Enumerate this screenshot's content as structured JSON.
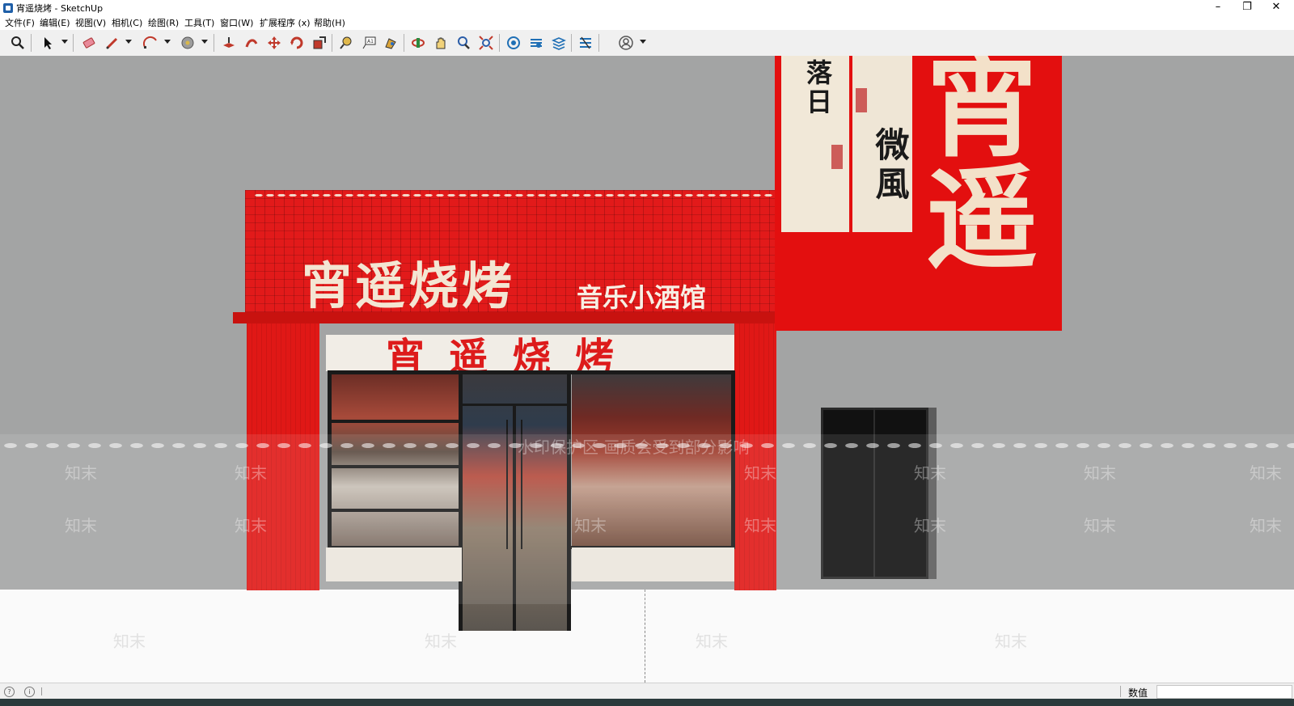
{
  "window": {
    "title": "宵遥烧烤 - SketchUp",
    "minimize": "–",
    "restore": "❐",
    "close": "✕"
  },
  "menu": [
    "文件(F)",
    "编辑(E)",
    "视图(V)",
    "相机(C)",
    "绘图(R)",
    "工具(T)",
    "窗口(W)",
    "扩展程序 (x)",
    "帮助(H)"
  ],
  "toolbar": {
    "tools": [
      "zoom-window-icon",
      "select-icon",
      "eraser-icon",
      "pencil-icon",
      "arc-icon",
      "paint-bucket-icon",
      "push-pull-icon",
      "follow-me-icon",
      "move-icon",
      "rotate-icon",
      "scale-icon",
      "tape-measure-icon",
      "text-icon",
      "paint-icon",
      "orbit-icon",
      "pan-icon",
      "zoom-icon",
      "zoom-extents-icon",
      "warehouse-icon",
      "extension-warehouse-icon",
      "layout-icon",
      "extension-manager-icon",
      "account-icon"
    ]
  },
  "scene": {
    "sign_main": "宵遥烧烤",
    "sign_sub": "音乐小酒馆",
    "header_band": "宵遥烧烤",
    "banner_big": "宵遥",
    "brush_a": "落日",
    "brush_b": "微風",
    "watermark_center": "水印保护区 画质会受到部分影响",
    "watermark_logo": "知末"
  },
  "colors": {
    "sign_red": "#e21a1a",
    "cream": "#f3e1c9",
    "wall_gray": "#a3a4a4"
  },
  "status": {
    "measure_label": "数值",
    "measure_value": ""
  }
}
